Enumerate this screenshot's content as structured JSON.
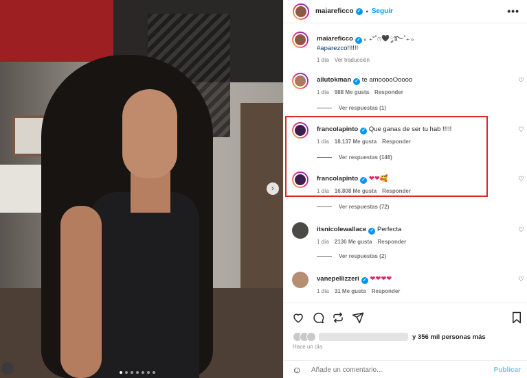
{
  "header": {
    "username": "maiareficco",
    "follow_label": "Seguir",
    "more_label": "•••"
  },
  "caption": {
    "username": "maiareficco",
    "text": "｡ ₊°˚ෆ🖤༘࿐˚₊ ｡",
    "hashtag": "#aparezco",
    "hashtag_suffix": "!!!!!!",
    "time": "1 día",
    "translate_label": "Ver traducción"
  },
  "comments": [
    {
      "username": "ailutokman",
      "text": "te amooooOoooo",
      "time": "1 día",
      "likes": "988 Me gusta",
      "reply_label": "Responder",
      "replies_label": "Ver respuestas (1)"
    },
    {
      "username": "francolapinto",
      "text": "Que ganas de ser tu hab !!!!!",
      "time": "1 día",
      "likes": "18.137 Me gusta",
      "reply_label": "Responder",
      "replies_label": "Ver respuestas (148)"
    },
    {
      "username": "francolapinto",
      "text": "❤❤🥰",
      "time": "1 día",
      "likes": "16.808 Me gusta",
      "reply_label": "Responder",
      "replies_label": "Ver respuestas (72)"
    },
    {
      "username": "itsnicolewallace",
      "text": "Perfecta",
      "time": "1 día",
      "likes": "2130 Me gusta",
      "reply_label": "Responder",
      "replies_label": "Ver respuestas (2)"
    },
    {
      "username": "vanepellizzeri",
      "text": "❤❤❤❤",
      "time": "1 día",
      "likes": "31 Me gusta",
      "reply_label": "Responder"
    }
  ],
  "actions": {
    "like_icon": "heart-icon",
    "comment_icon": "comment-icon",
    "share_icon": "repost-icon",
    "send_icon": "send-icon",
    "save_icon": "bookmark-icon"
  },
  "likes_text": "y 356 mil personas más",
  "time_ago": "Hace un día",
  "composer": {
    "placeholder": "Añade un comentario...",
    "publish_label": "Publicar"
  },
  "colors": {
    "accent": "#0095f6",
    "highlight": "#e0262b",
    "verified": "#0095f6"
  }
}
